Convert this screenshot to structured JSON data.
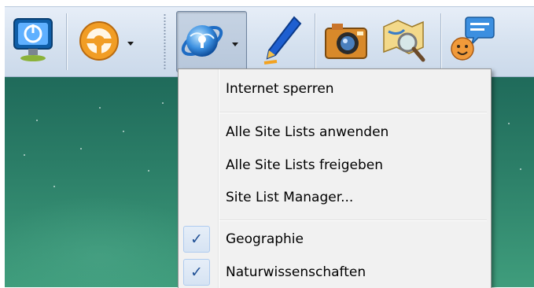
{
  "toolbar": {
    "buttons": [
      {
        "name": "monitor-power-button",
        "icon": "monitor-power-icon"
      },
      {
        "name": "steering-wheel-button",
        "icon": "steering-wheel-icon",
        "has_dropdown": true
      },
      {
        "name": "internet-lock-button",
        "icon": "globe-lock-icon",
        "has_dropdown": true,
        "pressed": true
      },
      {
        "name": "pen-button",
        "icon": "pen-icon"
      },
      {
        "name": "camera-button",
        "icon": "camera-icon"
      },
      {
        "name": "magnifier-button",
        "icon": "map-magnifier-icon"
      },
      {
        "name": "chat-button",
        "icon": "chat-bubble-icon"
      }
    ]
  },
  "menu": {
    "item_internet_lock": "Internet sperren",
    "item_apply_all": "Alle Site Lists anwenden",
    "item_release_all": "Alle Site Lists freigeben",
    "item_manager": "Site List Manager...",
    "item_geography": "Geographie",
    "item_science": "Naturwissenschaften",
    "check_glyph": "✓",
    "checked": [
      "Geographie",
      "Naturwissenschaften"
    ]
  },
  "colors": {
    "toolbar_bg": "#d5e1ef",
    "menu_bg": "#f1f1f1",
    "check_color": "#1f4f95",
    "desktop_bg": "#2c7f68"
  }
}
